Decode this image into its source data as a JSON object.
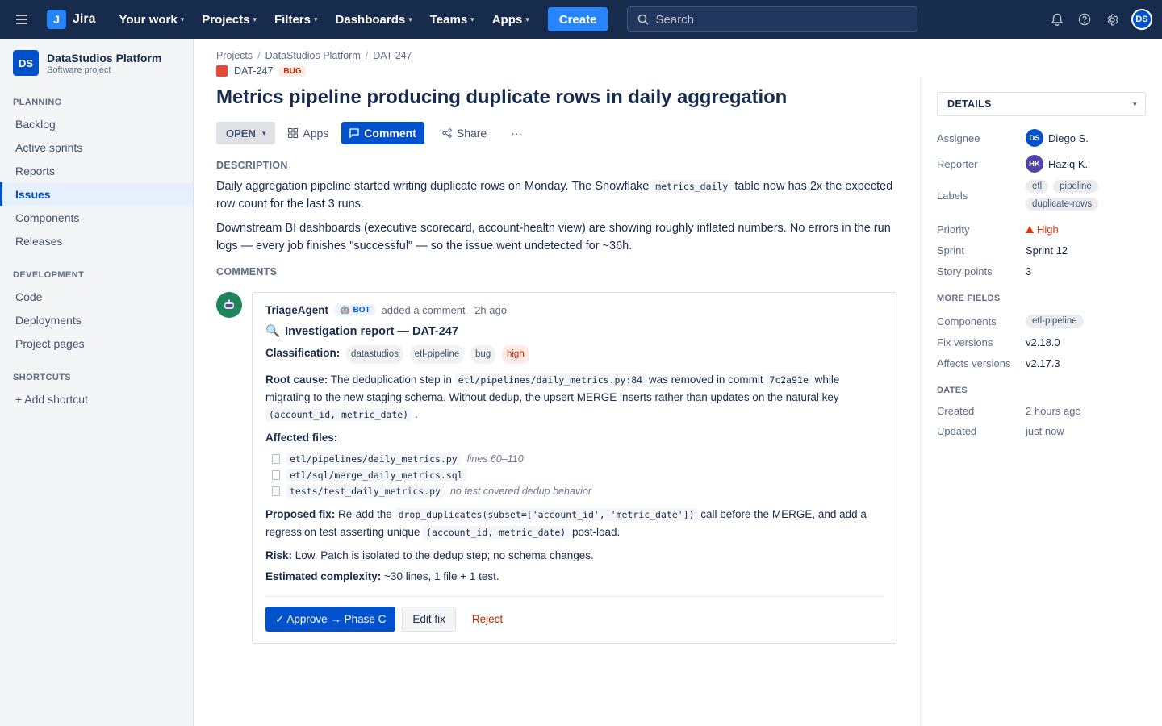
{
  "topbar": {
    "logo_letter": "J",
    "logo_text": "Jira",
    "nav": [
      "Your work",
      "Projects",
      "Filters",
      "Dashboards",
      "Teams",
      "Apps"
    ],
    "create_label": "Create",
    "search_placeholder": "Search",
    "user_initials": "DS"
  },
  "sidebar": {
    "project_badge": "DS",
    "project_name": "DataStudios Platform",
    "project_type": "Software project",
    "planning_heading": "PLANNING",
    "planning_items": [
      "Backlog",
      "Active sprints",
      "Reports",
      "Issues",
      "Components",
      "Releases"
    ],
    "development_heading": "DEVELOPMENT",
    "development_items": [
      "Code",
      "Deployments",
      "Project pages"
    ],
    "shortcuts_heading": "SHORTCUTS",
    "add_shortcut": "+ Add shortcut"
  },
  "issue": {
    "breadcrumb": [
      "Projects",
      "DataStudios Platform",
      "DAT-247"
    ],
    "key": "DAT-247",
    "type_badge": "BUG",
    "title": "Metrics pipeline producing duplicate rows in daily aggregation",
    "status": "OPEN",
    "apps_label": "Apps",
    "comment_label": "Comment",
    "share_label": "Share",
    "more_label": "···",
    "description_heading": "DESCRIPTION",
    "desc1_a": "Daily aggregation pipeline started writing duplicate rows on Monday. The Snowflake ",
    "desc1_code": "metrics_daily",
    "desc1_b": " table now has 2x the expected row count for the last 3 runs.",
    "desc2": "Downstream BI dashboards (executive scorecard, account-health view) are showing roughly inflated numbers. No errors in the run logs — every job finishes \"successful\" — so the issue went undetected for ~36h.",
    "comments_heading": "COMMENTS"
  },
  "comment": {
    "author": "TriageAgent",
    "bot_tag": "BOT",
    "meta": "added a comment · 2h ago",
    "report_icon": "🔍",
    "report_title": "Investigation report — DAT-247",
    "classification_label": "Classification:",
    "classification_tags": [
      "datastudios",
      "etl-pipeline",
      "bug",
      "high"
    ],
    "root_label": "Root cause:",
    "root_a": " The deduplication step in ",
    "root_code1": "etl/pipelines/daily_metrics.py:84",
    "root_b": " was removed in commit ",
    "root_code2": "7c2a91e",
    "root_c": " while migrating to the new staging schema. Without dedup, the upsert MERGE inserts rather than updates on the natural key ",
    "root_code3": "(account_id, metric_date)",
    "root_d": " .",
    "affected_label": "Affected files:",
    "files": [
      {
        "path": "etl/pipelines/daily_metrics.py",
        "note": "lines 60–110"
      },
      {
        "path": "etl/sql/merge_daily_metrics.sql",
        "note": ""
      },
      {
        "path": "tests/test_daily_metrics.py",
        "note": "no test covered dedup behavior"
      }
    ],
    "fix_label": "Proposed fix:",
    "fix_a": " Re-add the ",
    "fix_code1": "drop_duplicates(subset=['account_id', 'metric_date'])",
    "fix_b": " call before the MERGE, and add a regression test asserting unique ",
    "fix_code2": "(account_id, metric_date)",
    "fix_c": " post-load.",
    "risk_label": "Risk:",
    "risk_text": " Low. Patch is isolated to the dedup step; no schema changes.",
    "complexity_label": "Estimated complexity:",
    "complexity_text": " ~30 lines, 1 file + 1 test.",
    "approve_label": "✓ Approve → Phase C",
    "edit_label": "Edit fix",
    "reject_label": "Reject"
  },
  "details": {
    "heading": "DETAILS",
    "assignee_label": "Assignee",
    "assignee_initials": "DS",
    "assignee_name": "Diego S.",
    "reporter_label": "Reporter",
    "reporter_initials": "HK",
    "reporter_name": "Haziq K.",
    "labels_label": "Labels",
    "labels": [
      "etl",
      "pipeline",
      "duplicate-rows"
    ],
    "priority_label": "Priority",
    "priority_value": "High",
    "sprint_label": "Sprint",
    "sprint_value": "Sprint 12",
    "points_label": "Story points",
    "points_value": "3",
    "more_fields_heading": "MORE FIELDS",
    "components_label": "Components",
    "components_value": "etl-pipeline",
    "fix_versions_label": "Fix versions",
    "fix_versions_value": "v2.18.0",
    "affects_label": "Affects versions",
    "affects_value": "v2.17.3",
    "dates_heading": "DATES",
    "created_label": "Created",
    "created_value": "2 hours ago",
    "updated_label": "Updated",
    "updated_value": "just now"
  },
  "colors": {
    "topbar": "#172b4d",
    "brand_blue": "#0052cc",
    "bug_red": "#e5493a",
    "priority_high": "#de350b",
    "bot_green": "#1f845a",
    "reporter_purple": "#5243aa"
  }
}
